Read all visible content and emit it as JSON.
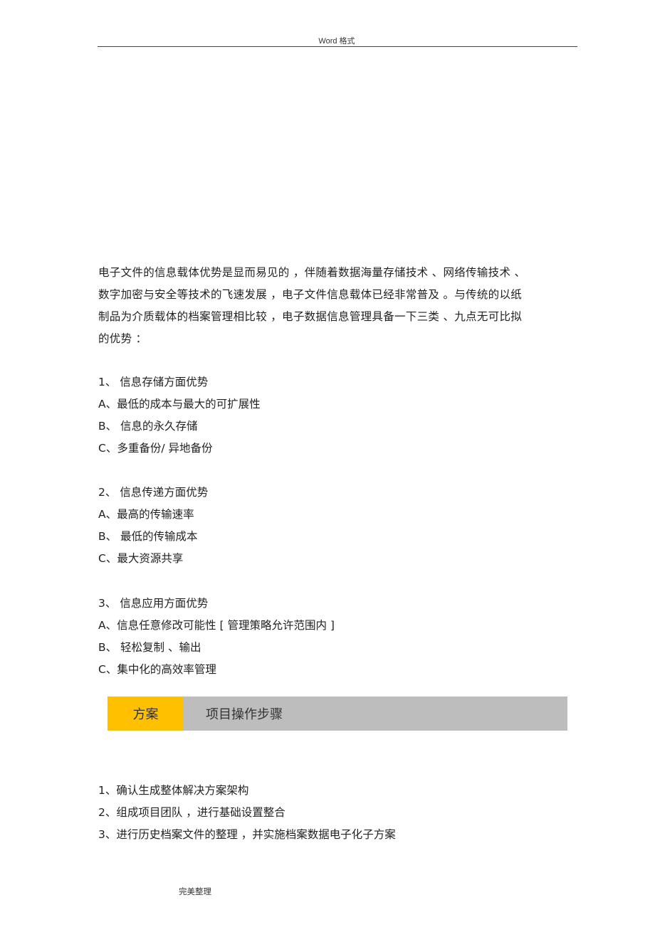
{
  "header": {
    "text": "Word 格式"
  },
  "intro": {
    "lines": [
      "电子文件的信息载体优势是显而易见的 ，伴随着数据海量存储技术 、网络传输技术 、",
      "数字加密与安全等技术的飞速发展 ，电子文件信息载体已经非常普及 。与传统的以纸",
      "制品为介质载体的档案管理相比较 ，电子数据信息管理具备一下三类 、九点无可比拟",
      "的优势 ："
    ]
  },
  "sections": [
    {
      "heading": "1、  信息存储方面优势",
      "items": [
        "A、最低的成本与最大的可扩展性",
        "B、  信息的永久存储",
        "C、多重备份/ 异地备份"
      ]
    },
    {
      "heading": "2、  信息传递方面优势",
      "items": [
        "A、最高的传输速率",
        "B、  最低的传输成本",
        "C、最大资源共享"
      ]
    },
    {
      "heading": "3、  信息应用方面优势",
      "items": [
        "A、信息任意修改可能性 [  管理策略允许范围内  ]",
        "B、  轻松复制 、输出",
        "C、集中化的高效率管理"
      ]
    }
  ],
  "banner": {
    "tag": "方案",
    "title": "项目操作步骤",
    "tag_color": "#ffc000",
    "bar_color": "#bdbdbd"
  },
  "steps": [
    "1、确认生成整体解决方案架构",
    "2、组成项目团队 ，进行基础设置整合",
    "3、进行历史档案文件的整理 ，并实施档案数据电子化子方案"
  ],
  "footer": {
    "text": "完美整理"
  }
}
